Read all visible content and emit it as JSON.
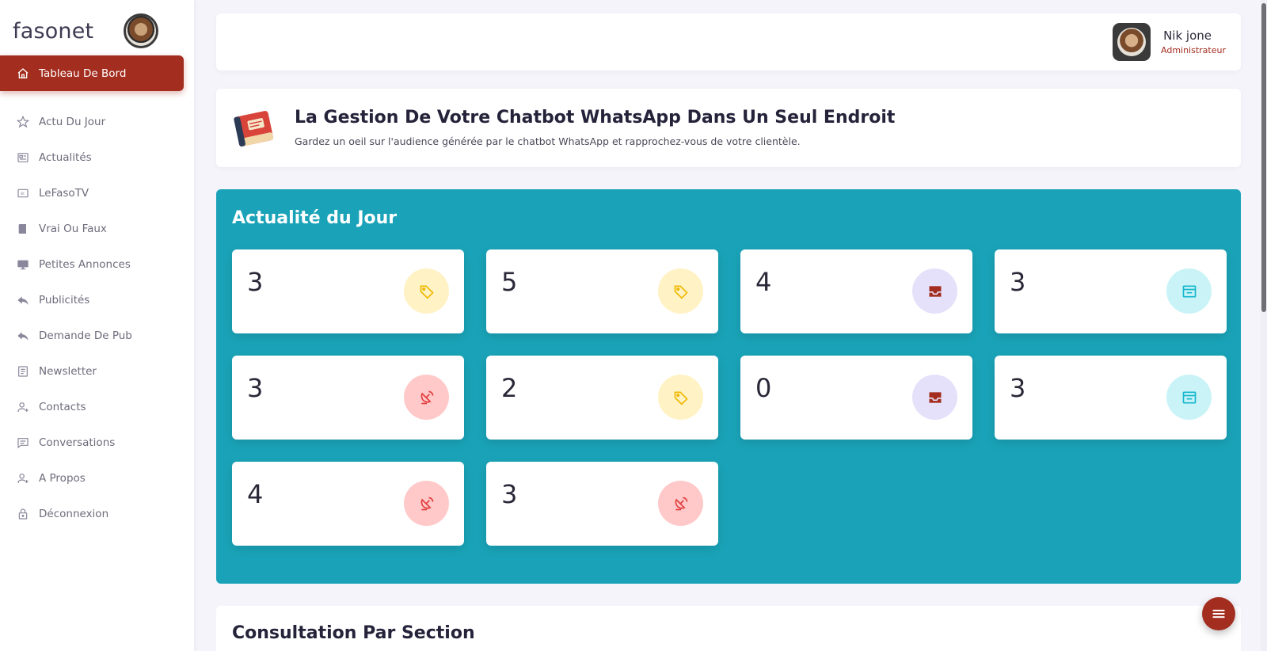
{
  "brand": {
    "name": "fasonet",
    "logo_icon": "brand-logo-icon"
  },
  "sidebar": {
    "items": [
      {
        "label": "Tableau De Bord",
        "icon": "home-icon",
        "active": true
      },
      {
        "label": "Actu Du Jour",
        "icon": "star-icon"
      },
      {
        "label": "Actualités",
        "icon": "newspaper-icon"
      },
      {
        "label": "LeFasoTV",
        "icon": "video-icon"
      },
      {
        "label": "Vrai Ou Faux",
        "icon": "book-icon"
      },
      {
        "label": "Petites Annonces",
        "icon": "monitor-icon"
      },
      {
        "label": "Publicités",
        "icon": "reply-icon"
      },
      {
        "label": "Demande De Pub",
        "icon": "reply-icon"
      },
      {
        "label": "Newsletter",
        "icon": "document-icon"
      },
      {
        "label": "Contacts",
        "icon": "user-plus-icon"
      },
      {
        "label": "Conversations",
        "icon": "chat-icon"
      },
      {
        "label": "A Propos",
        "icon": "user-plus-icon"
      },
      {
        "label": "Déconnexion",
        "icon": "lock-icon"
      }
    ]
  },
  "topbar": {
    "user_name": "Nik jone",
    "user_role": "Administrateur"
  },
  "hero": {
    "title": "La Gestion De Votre Chatbot WhatsApp Dans Un Seul Endroit",
    "subtitle": "Gardez un oeil sur l'audience générée par le chatbot WhatsApp et rapprochez-vous de votre clientèle."
  },
  "panel": {
    "title": "Actualité du Jour",
    "cards": [
      {
        "value": "3",
        "icon": "tag-icon",
        "color": "yellow"
      },
      {
        "value": "5",
        "icon": "tag-icon",
        "color": "yellow"
      },
      {
        "value": "4",
        "icon": "inbox-icon",
        "color": "purple"
      },
      {
        "value": "3",
        "icon": "archive-icon",
        "color": "cyan"
      },
      {
        "value": "3",
        "icon": "satellite-dish-icon",
        "color": "red"
      },
      {
        "value": "2",
        "icon": "tag-icon",
        "color": "yellow"
      },
      {
        "value": "0",
        "icon": "inbox-icon",
        "color": "purple"
      },
      {
        "value": "3",
        "icon": "archive-icon",
        "color": "cyan"
      },
      {
        "value": "4",
        "icon": "satellite-dish-icon",
        "color": "red"
      },
      {
        "value": "3",
        "icon": "satellite-dish-icon",
        "color": "red"
      }
    ]
  },
  "bottom": {
    "title": "Consultation Par Section"
  },
  "colors": {
    "accent": "#a32d1f",
    "panel": "#1aa3b8",
    "background": "#f5f4fb"
  }
}
